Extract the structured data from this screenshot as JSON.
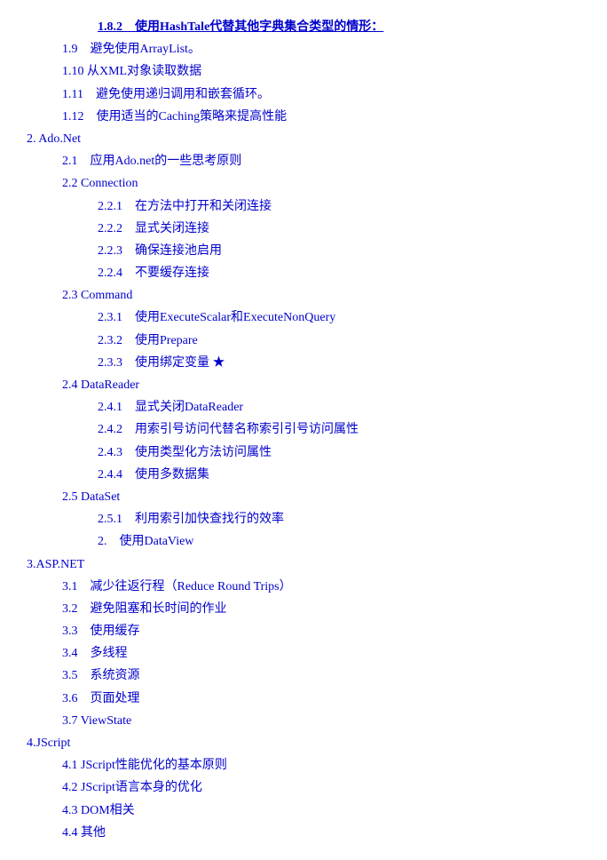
{
  "toc": {
    "items": [
      {
        "id": "1",
        "level": "level-3 bold-underline",
        "indent": 3,
        "text": "1.8.2　使用HashTale代替其他字典集合类型的情形：",
        "bold": true
      },
      {
        "id": "2",
        "level": "level-2",
        "indent": 2,
        "text": "1.9　避免使用ArrayList。"
      },
      {
        "id": "3",
        "level": "level-2",
        "indent": 2,
        "text": "1.10 从XML对象读取数据"
      },
      {
        "id": "4",
        "level": "level-2",
        "indent": 2,
        "text": "1.11　避免使用递归调用和嵌套循环。"
      },
      {
        "id": "5",
        "level": "level-2",
        "indent": 2,
        "text": "1.12　使用适当的Caching策略来提高性能"
      },
      {
        "id": "6",
        "level": "level-1",
        "indent": 1,
        "text": "2. Ado.Net"
      },
      {
        "id": "7",
        "level": "level-2",
        "indent": 2,
        "text": "2.1　应用Ado.net的一些思考原则"
      },
      {
        "id": "8",
        "level": "level-2",
        "indent": 2,
        "text": "2.2 Connection"
      },
      {
        "id": "9",
        "level": "level-3",
        "indent": 3,
        "text": "2.2.1　在方法中打开和关闭连接"
      },
      {
        "id": "10",
        "level": "level-3",
        "indent": 3,
        "text": "2.2.2　显式关闭连接"
      },
      {
        "id": "11",
        "level": "level-3",
        "indent": 3,
        "text": "2.2.3　确保连接池启用"
      },
      {
        "id": "12",
        "level": "level-3",
        "indent": 3,
        "text": "2.2.4　不要缓存连接"
      },
      {
        "id": "13",
        "level": "level-2",
        "indent": 2,
        "text": "2.3 Command"
      },
      {
        "id": "14",
        "level": "level-3",
        "indent": 3,
        "text": "2.3.1　使用ExecuteScalar和ExecuteNonQuery"
      },
      {
        "id": "15",
        "level": "level-3",
        "indent": 3,
        "text": "2.3.2　使用Prepare"
      },
      {
        "id": "16",
        "level": "level-3",
        "indent": 3,
        "text": "2.3.3　使用绑定变量  ★",
        "star": true
      },
      {
        "id": "17",
        "level": "level-2",
        "indent": 2,
        "text": "2.4 DataReader"
      },
      {
        "id": "18",
        "level": "level-3",
        "indent": 3,
        "text": "2.4.1　显式关闭DataReader"
      },
      {
        "id": "19",
        "level": "level-3",
        "indent": 3,
        "text": "2.4.2　用索引号访问代替名称索引引号访问属性"
      },
      {
        "id": "20",
        "level": "level-3",
        "indent": 3,
        "text": "2.4.3　使用类型化方法访问属性"
      },
      {
        "id": "21",
        "level": "level-3",
        "indent": 3,
        "text": "2.4.4　使用多数据集"
      },
      {
        "id": "22",
        "level": "level-2",
        "indent": 2,
        "text": "2.5 DataSet"
      },
      {
        "id": "23",
        "level": "level-3",
        "indent": 3,
        "text": "2.5.1　利用索引加快查找行的效率"
      },
      {
        "id": "24",
        "level": "level-3",
        "indent": 3,
        "text": "2.　使用DataView"
      },
      {
        "id": "25",
        "level": "level-1",
        "indent": 1,
        "text": "3.ASP.NET"
      },
      {
        "id": "26",
        "level": "level-2",
        "indent": 2,
        "text": "3.1　减少往返行程（Reduce Round Trips）"
      },
      {
        "id": "27",
        "level": "level-2",
        "indent": 2,
        "text": "3.2　避免阻塞和长时间的作业"
      },
      {
        "id": "28",
        "level": "level-2",
        "indent": 2,
        "text": "3.3　使用缓存"
      },
      {
        "id": "29",
        "level": "level-2",
        "indent": 2,
        "text": "3.4　多线程"
      },
      {
        "id": "30",
        "level": "level-2",
        "indent": 2,
        "text": "3.5　系统资源"
      },
      {
        "id": "31",
        "level": "level-2",
        "indent": 2,
        "text": "3.6　页面处理"
      },
      {
        "id": "32",
        "level": "level-2",
        "indent": 2,
        "text": "3.7 ViewState"
      },
      {
        "id": "33",
        "level": "level-1",
        "indent": 1,
        "text": "4.JScript"
      },
      {
        "id": "34",
        "level": "level-2",
        "indent": 2,
        "text": "4.1 JScript性能优化的基本原则"
      },
      {
        "id": "35",
        "level": "level-2",
        "indent": 2,
        "text": "4.2 JScript语言本身的优化"
      },
      {
        "id": "36",
        "level": "level-2",
        "indent": 2,
        "text": "4.3 DOM相关"
      },
      {
        "id": "37",
        "level": "level-2",
        "indent": 2,
        "text": "4.4  其他"
      }
    ]
  }
}
